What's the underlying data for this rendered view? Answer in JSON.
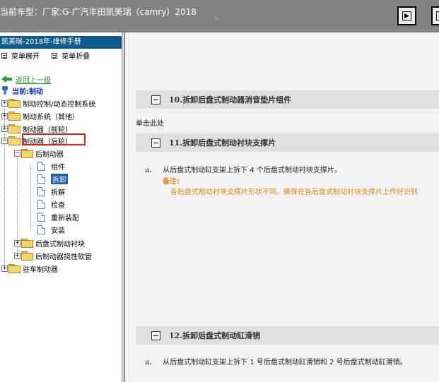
{
  "window": {
    "title": "当前车型：厂家:G-广汽丰田凯美瑞（camry）2018",
    "dot": "."
  },
  "sidebar": {
    "book_title": "凯美瑞-2018年-维修手册",
    "expand_label": "菜单展开",
    "collapse_label": "菜单折叠",
    "back_label": "返回上一级",
    "current_label": "当前:制动",
    "tree": {
      "brake_control": "制动控制/动态控制系统",
      "brake_system_other": "制动系统（其他）",
      "brake_front": "制动器（前轮）",
      "brake_rear": "制动器（后轮）",
      "rear_brake": "后制动器",
      "components": "组件",
      "removal": "拆卸",
      "disassembly": "拆解",
      "inspection": "检查",
      "reassembly": "重新装配",
      "installation": "安装",
      "rear_disc_pad_support": "后盘式制动衬块",
      "rear_brake_flex_hose": "后制动器挠性软管",
      "parking_brake": "驻车制动器"
    }
  },
  "content": {
    "sec10_title": "10.拆卸后盘式制动器消音垫片组件",
    "click_here": "单击此处",
    "sec11_title": "11.拆卸后盘式制动衬块支撑片",
    "sec11_step_label": "a.",
    "sec11_step_text": "从后盘式制动缸支架上拆下 4 个后盘式制动衬块支撑片。",
    "note_heading": "备注:",
    "note_text": "各后盘式制动衬块支撑片形状不同。确保在各后盘式制动衬块支撑片上作好识别",
    "sec12_title": "12.拆卸后盘式制动缸滑销",
    "sec12_step_label": "a.",
    "sec12_step_text": "从后盘式制动缸支架上拆下 1 号后盘式制动缸滑销和 2 号后盘式制动缸滑销。"
  },
  "icons": {
    "window_btn_1": "restore-icon",
    "window_btn_2": "window-icon"
  },
  "colors": {
    "topbar": "#838383",
    "book_title_bg": "#0f5a8c",
    "selected": "#1e5fb4",
    "note": "#e0881a",
    "highlight_box": "#e02020"
  }
}
